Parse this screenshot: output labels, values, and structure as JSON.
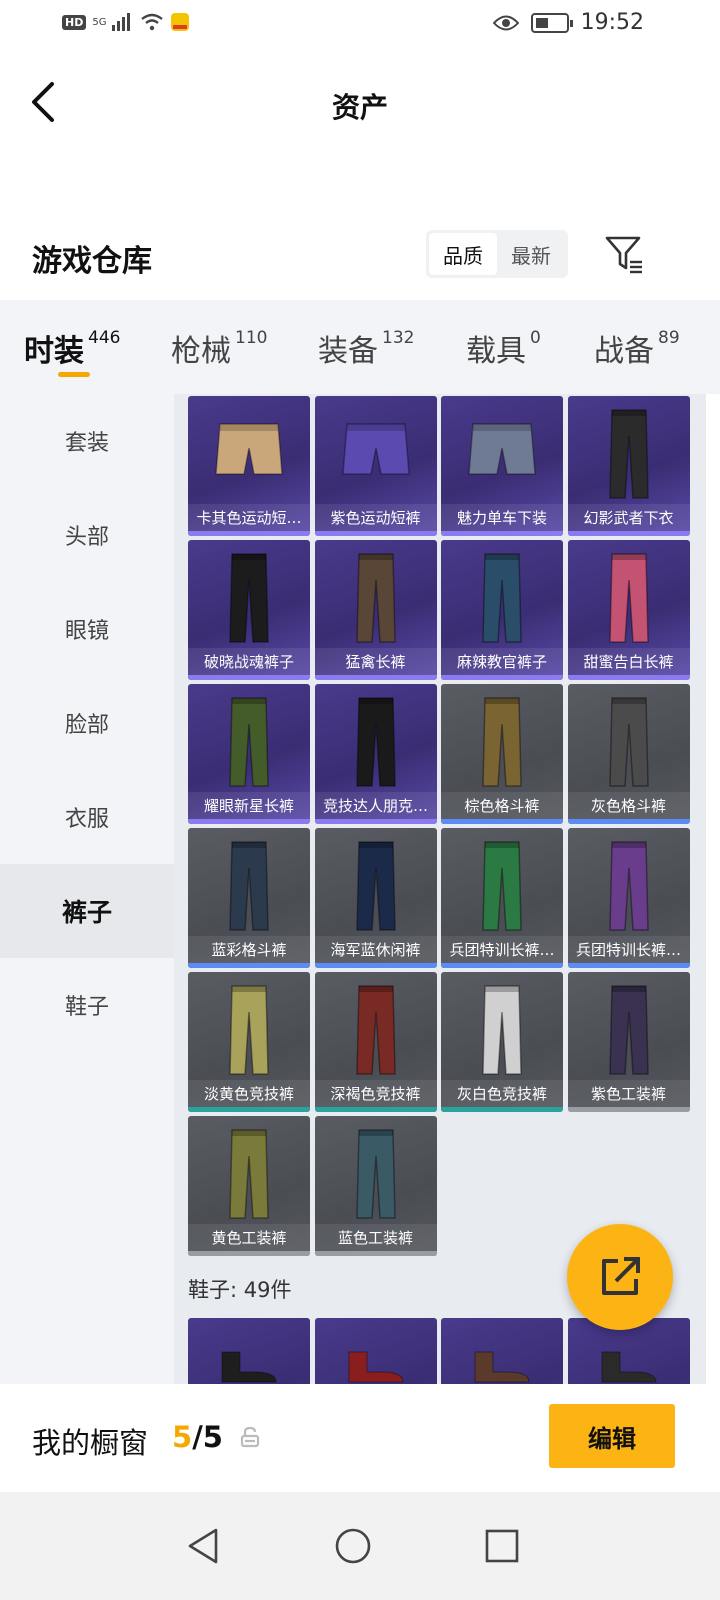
{
  "status_bar": {
    "hd": "HD",
    "network": "5G",
    "time": "19:52"
  },
  "header": {
    "title": "资产"
  },
  "warehouse": {
    "title": "游戏仓库",
    "sort_options": [
      "品质",
      "最新"
    ],
    "active_sort": "品质"
  },
  "tabs": [
    {
      "label": "时装",
      "count": "446"
    },
    {
      "label": "枪械",
      "count": "110"
    },
    {
      "label": "装备",
      "count": "132"
    },
    {
      "label": "载具",
      "count": "0"
    },
    {
      "label": "战备",
      "count": "89"
    }
  ],
  "sidebar": {
    "items": [
      "套装",
      "头部",
      "眼镜",
      "脸部",
      "衣服",
      "裤子",
      "鞋子"
    ],
    "active": "裤子"
  },
  "items": [
    {
      "name": "卡其色运动短…",
      "quality": "purple"
    },
    {
      "name": "紫色运动短裤",
      "quality": "purple"
    },
    {
      "name": "魅力单车下装",
      "quality": "purple"
    },
    {
      "name": "幻影武者下衣",
      "quality": "purple"
    },
    {
      "name": "破晓战魂裤子",
      "quality": "purple"
    },
    {
      "name": "猛禽长裤",
      "quality": "purple"
    },
    {
      "name": "麻辣教官裤子",
      "quality": "purple"
    },
    {
      "name": "甜蜜告白长裤",
      "quality": "purple"
    },
    {
      "name": "耀眼新星长裤",
      "quality": "purple"
    },
    {
      "name": "竞技达人朋克…",
      "quality": "purple"
    },
    {
      "name": "棕色格斗裤",
      "quality": "blue"
    },
    {
      "name": "灰色格斗裤",
      "quality": "blue"
    },
    {
      "name": "蓝彩格斗裤",
      "quality": "blue"
    },
    {
      "name": "海军蓝休闲裤",
      "quality": "blue"
    },
    {
      "name": "兵团特训长裤…",
      "quality": "blue"
    },
    {
      "name": "兵团特训长裤…",
      "quality": "blue"
    },
    {
      "name": "淡黄色竞技裤",
      "quality": "teal"
    },
    {
      "name": "深褐色竞技裤",
      "quality": "teal"
    },
    {
      "name": "灰白色竞技裤",
      "quality": "teal"
    },
    {
      "name": "紫色工装裤",
      "quality": "gray"
    },
    {
      "name": "黄色工装裤",
      "quality": "gray"
    },
    {
      "name": "蓝色工装裤",
      "quality": "gray"
    }
  ],
  "next_section": {
    "label": "鞋子: 49件"
  },
  "showcase": {
    "label": "我的橱窗",
    "current": "5",
    "separator": "/",
    "total": "5",
    "edit_label": "编辑"
  },
  "colors": {
    "accent": "#fbb413",
    "tab_underline": "#f5a800",
    "purple_card": "#3a2d73",
    "gray_card": "#4b4d54"
  }
}
